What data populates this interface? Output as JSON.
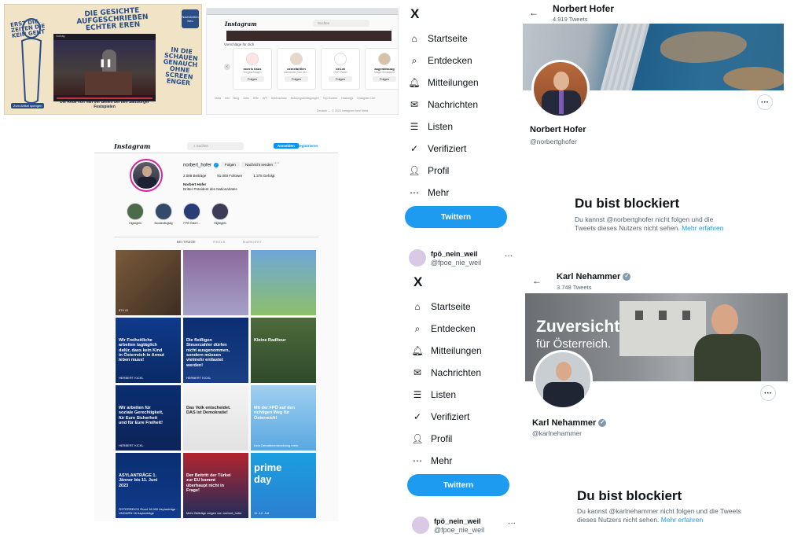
{
  "poster": {
    "headline": "DIE GESICHTE AUFGESCHRIEBEN ECHTER EREN",
    "logo": "Nachrichten Neu",
    "side_text": "IN DIE SCHAUEN GENAUCH OHNE SCREEN ENGER",
    "left_text": "ERST DIE ZEITEN DIE KEIN GEHT",
    "video_header": "Vortrag",
    "video_title": "Die Rede von Van der Bellen bei den Salzburger Festspielen",
    "link_button": "Zum Artikel springen"
  },
  "ig_small": {
    "brand": "Instagram",
    "search_placeholder": "Suchen",
    "section_label": "Vorschläge für dich",
    "cards": [
      {
        "name": "morris haus",
        "sub": "Vorgeschlagen",
        "button": "Folgen"
      },
      {
        "name": "oemelbrillen",
        "sub": "Alexander Van der...",
        "button": "Folgen"
      },
      {
        "name": "oe1.at",
        "sub": "ÖVP Partei",
        "button": "Folgen"
      },
      {
        "name": "augenbrauug",
        "sub": "Magic Dinslaken",
        "button": "Folgen"
      }
    ],
    "footer_links": [
      "Meta",
      "Info",
      "Blog",
      "Jobs",
      "Hilfe",
      "API",
      "Datenschutz",
      "Nutzungsbedingungen",
      "Top-Konten",
      "Hashtags",
      "Instagram Lite"
    ],
    "footer_lang": "Deutsch",
    "footer_copy": "© 2023 Instagram from Meta"
  },
  "ig_profile": {
    "brand": "Instagram",
    "search_placeholder": "Suchen",
    "login_button": "Anmelden",
    "signup_link": "Registrieren",
    "username": "norbert_hofer",
    "follow_button": "Folgen",
    "message_button": "Nachricht senden",
    "stats": [
      "2.089 Beiträge",
      "91.000 Follower",
      "1.378 Gefolgt"
    ],
    "bio_name": "Norbert Hofer",
    "bio_desc": "Dritter Präsident des Nationalrates",
    "highlights": [
      "Highlights",
      "Bundesflugtag",
      "FPÖ Österr...",
      "Highlights"
    ],
    "tabs": [
      "BEITRÄGE",
      "REELS",
      "MARKIERT"
    ],
    "posts": [
      {
        "text": "",
        "caption": "574  41"
      },
      {
        "text": "",
        "caption": ""
      },
      {
        "text": "",
        "caption": ""
      },
      {
        "text": "Wir Freiheitliche arbeiten tagtäglich dafür, dass kein Kind in Österreich in Armut leben muss!",
        "caption": "HERBERT KICKL"
      },
      {
        "text": "Die fleißigen Steuerzahler dürfen nicht ausgenommen, sondern müssen vielmehr entlastet werden!",
        "caption": "HERBERT KICKL"
      },
      {
        "text": "Kleine Radltour",
        "caption": ""
      },
      {
        "text": "Wir arbeiten für soziale Gerechtigkeit, für Eure Sicherheit und für Eure Freiheit!",
        "caption": "HERBERT KICKL"
      },
      {
        "text": "Das Volk entscheidet. DAS ist Demokratie!",
        "caption": ""
      },
      {
        "text": "Mit der FPÖ auf den richtigen Weg für Österreich!",
        "caption": "Kein Debattenentwicklung mehr"
      },
      {
        "text": "ASYLANTRÄGE 1. Jänner bis 11. Juni 2023",
        "caption": "ÖSTERREICH Rund 18.000 Asylanträge · UNGARN 16 Asylanträge"
      },
      {
        "text": "Der Beitritt der Türkei zur EU kommt überhaupt nicht in Frage!",
        "caption": "Mehr Beiträge zeigen von norbert_hofer"
      },
      {
        "text": "prime day",
        "caption": "11.-12. Juli"
      }
    ]
  },
  "twitter_nav_1": {
    "logo": "X",
    "items": [
      "Startseite",
      "Entdecken",
      "Mitteilungen",
      "Nachrichten",
      "Listen",
      "Verifiziert",
      "Profil",
      "Mehr"
    ],
    "tweet_button": "Twittern",
    "account_name": "fpö_nein_weil",
    "account_handle": "@fpoe_nie_weil",
    "more": "···"
  },
  "twitter_nav_2": {
    "logo": "X",
    "items": [
      "Startseite",
      "Entdecken",
      "Mitteilungen",
      "Nachrichten",
      "Listen",
      "Verifiziert",
      "Profil",
      "Mehr"
    ],
    "tweet_button": "Twittern",
    "account_name": "fpö_nein_weil",
    "account_handle": "@fpoe_nie_weil",
    "more": "···"
  },
  "profile_hofer": {
    "back": "←",
    "name": "Norbert Hofer",
    "tweet_count": "4.919 Tweets",
    "display_name": "Norbert Hofer",
    "handle": "@norbertghofer",
    "more": "···",
    "blocked_title": "Du bist blockiert",
    "blocked_text": "Du kannst @norbertghofer nicht folgen und die Tweets dieses Nutzers nicht sehen.",
    "learn_more": "Mehr erfahren"
  },
  "profile_nehammer": {
    "back": "←",
    "name": "Karl Nehammer",
    "tweet_count": "3.748 Tweets",
    "banner_line1": "Zuversicht",
    "banner_line2": "für Österreich.",
    "display_name": "Karl Nehammer",
    "handle": "@karlnehammer",
    "more": "···",
    "blocked_title": "Du bist blockiert",
    "blocked_text": "Du kannst @karlnehammer nicht folgen und die Tweets dieses Nutzers nicht sehen.",
    "learn_more": "Mehr erfahren"
  },
  "colors": {
    "twitter_blue": "#1d9bf0",
    "ig_blue": "#0095f6",
    "fpo_blue": "#0a3b8f",
    "poster_blue": "#2a4d86"
  }
}
